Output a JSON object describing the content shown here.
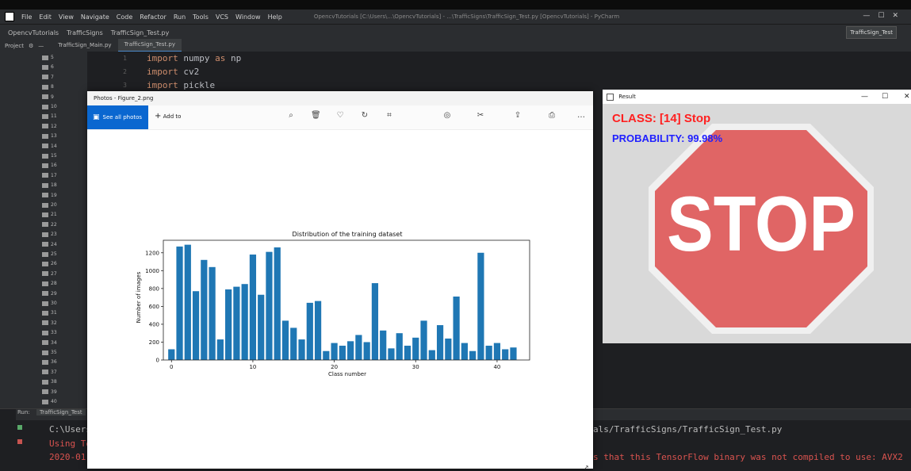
{
  "ide": {
    "menu": [
      "File",
      "Edit",
      "View",
      "Navigate",
      "Code",
      "Refactor",
      "Run",
      "Tools",
      "VCS",
      "Window",
      "Help"
    ],
    "title": "OpencvTutorials [C:\\Users\\...\\OpencvTutorials] - ...\\TrafficSigns\\TrafficSign_Test.py [OpencvTutorials] - PyCharm",
    "breadcrumbs": [
      "OpencvTutorials",
      "TrafficSigns",
      "TrafficSign_Test.py"
    ],
    "run_config": "TrafficSign_Test",
    "project_label": "Project",
    "tabs": [
      "TrafficSign_Main.py",
      "TrafficSign_Test.py"
    ],
    "folders": [
      "5",
      "6",
      "7",
      "8",
      "9",
      "10",
      "11",
      "12",
      "13",
      "14",
      "15",
      "16",
      "17",
      "18",
      "19",
      "20",
      "21",
      "22",
      "23",
      "24",
      "25",
      "26",
      "27",
      "28",
      "29",
      "30",
      "31",
      "32",
      "33",
      "34",
      "35",
      "36",
      "37",
      "38",
      "39",
      "40"
    ],
    "code_lines": [
      {
        "n": "1",
        "kw": "import",
        "rest": " numpy ",
        "kw2": "as",
        "rest2": " np"
      },
      {
        "n": "2",
        "kw": "import",
        "rest": " cv2",
        "kw2": "",
        "rest2": ""
      },
      {
        "n": "3",
        "kw": "import",
        "rest": " pickle",
        "kw2": "",
        "rest2": ""
      }
    ],
    "run_tab": "TrafficSign_Test",
    "run_label": "Run:",
    "run_lines_left": [
      "C:\\Users",
      "Using Te",
      "2020-01"
    ],
    "run_line_right_1": "als/TrafficSigns/TrafficSign_Test.py",
    "run_line_right_2": "s that this TensorFlow binary was not compiled to use: AVX2"
  },
  "photos": {
    "window_title": "Photos - Figure_2.png",
    "see_all": "See all photos",
    "add_to": "Add to"
  },
  "chart_data": {
    "type": "bar",
    "title": "Distribution of the training dataset",
    "xlabel": "Class number",
    "ylabel": "Number of images",
    "categories": [
      0,
      1,
      2,
      3,
      4,
      5,
      6,
      7,
      8,
      9,
      10,
      11,
      12,
      13,
      14,
      15,
      16,
      17,
      18,
      19,
      20,
      21,
      22,
      23,
      24,
      25,
      26,
      27,
      28,
      29,
      30,
      31,
      32,
      33,
      34,
      35,
      36,
      37,
      38,
      39,
      40,
      41,
      42
    ],
    "values": [
      120,
      1270,
      1290,
      770,
      1120,
      1040,
      230,
      790,
      820,
      850,
      1180,
      730,
      1210,
      1260,
      440,
      360,
      230,
      640,
      660,
      100,
      190,
      160,
      210,
      280,
      200,
      860,
      330,
      130,
      300,
      160,
      250,
      440,
      110,
      390,
      240,
      710,
      190,
      100,
      1200,
      160,
      190,
      120,
      140
    ],
    "xticks": [
      0,
      10,
      20,
      30,
      40
    ],
    "yticks": [
      0,
      200,
      400,
      600,
      800,
      1000,
      1200
    ],
    "xlim": [
      -1,
      44
    ],
    "ylim": [
      0,
      1340
    ],
    "color": "#1f77b4",
    "grid": false
  },
  "result": {
    "window_title": "Result",
    "class_text": "CLASS:  [14] Stop",
    "prob_text": "PROBABILITY: 99.98%",
    "sign_text": "STOP",
    "class_color": "#ff2020",
    "prob_color": "#2020ff"
  }
}
